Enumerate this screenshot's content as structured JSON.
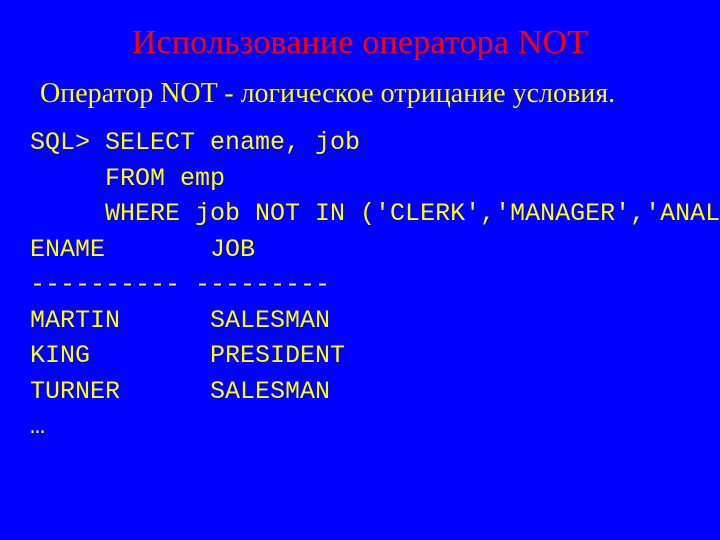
{
  "title": "Использование оператора NOT",
  "description": "Оператор NOT  - логическое отрицание условия.",
  "code": {
    "l1": "SQL> SELECT ename, job",
    "l2": "     FROM emp",
    "l3": "     WHERE job NOT IN ('CLERK','MANAGER','ANALYST');",
    "l4": "ENAME       JOB",
    "l5": "---------- ---------",
    "l6": "MARTIN      SALESMAN",
    "l7": "KING        PRESIDENT",
    "l8": "TURNER      SALESMAN",
    "l9": "…"
  }
}
